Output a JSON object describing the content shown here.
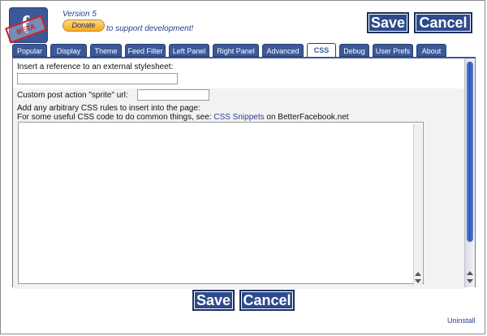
{
  "header": {
    "version": "Version 5",
    "donate_label": "Donate",
    "support_text": "to support development!",
    "logo_stamp": "BETA"
  },
  "actions": {
    "save_label": "Save",
    "cancel_label": "Cancel"
  },
  "tabs": [
    {
      "label": "Popular",
      "active": false
    },
    {
      "label": "Display",
      "active": false
    },
    {
      "label": "Theme",
      "active": false
    },
    {
      "label": "Feed Filter",
      "active": false
    },
    {
      "label": "Left Panel",
      "active": false
    },
    {
      "label": "Right Panel",
      "active": false
    },
    {
      "label": "Advanced",
      "active": false
    },
    {
      "label": "CSS",
      "active": true
    },
    {
      "label": "Debug",
      "active": false
    },
    {
      "label": "User Prefs",
      "active": false
    },
    {
      "label": "About",
      "active": false
    }
  ],
  "css_panel": {
    "external_stylesheet_label": "Insert a reference to an external stylesheet:",
    "external_stylesheet_value": "",
    "sprite_url_label": "Custom post action \"sprite\" url:",
    "sprite_url_value": "",
    "rules_label": "Add any arbitrary CSS rules to insert into the page:",
    "snippets_prefix": "For some useful CSS code to do common things, see:",
    "snippets_link": "CSS Snippets",
    "snippets_suffix": "on BetterFacebook.net",
    "rules_value": ""
  },
  "footer": {
    "uninstall_label": "Uninstall"
  },
  "colors": {
    "accent": "#3b5998",
    "button_bg": "#2d4a8c",
    "link": "#2d3d8f",
    "scroll_thumb": "#2a56b8"
  }
}
